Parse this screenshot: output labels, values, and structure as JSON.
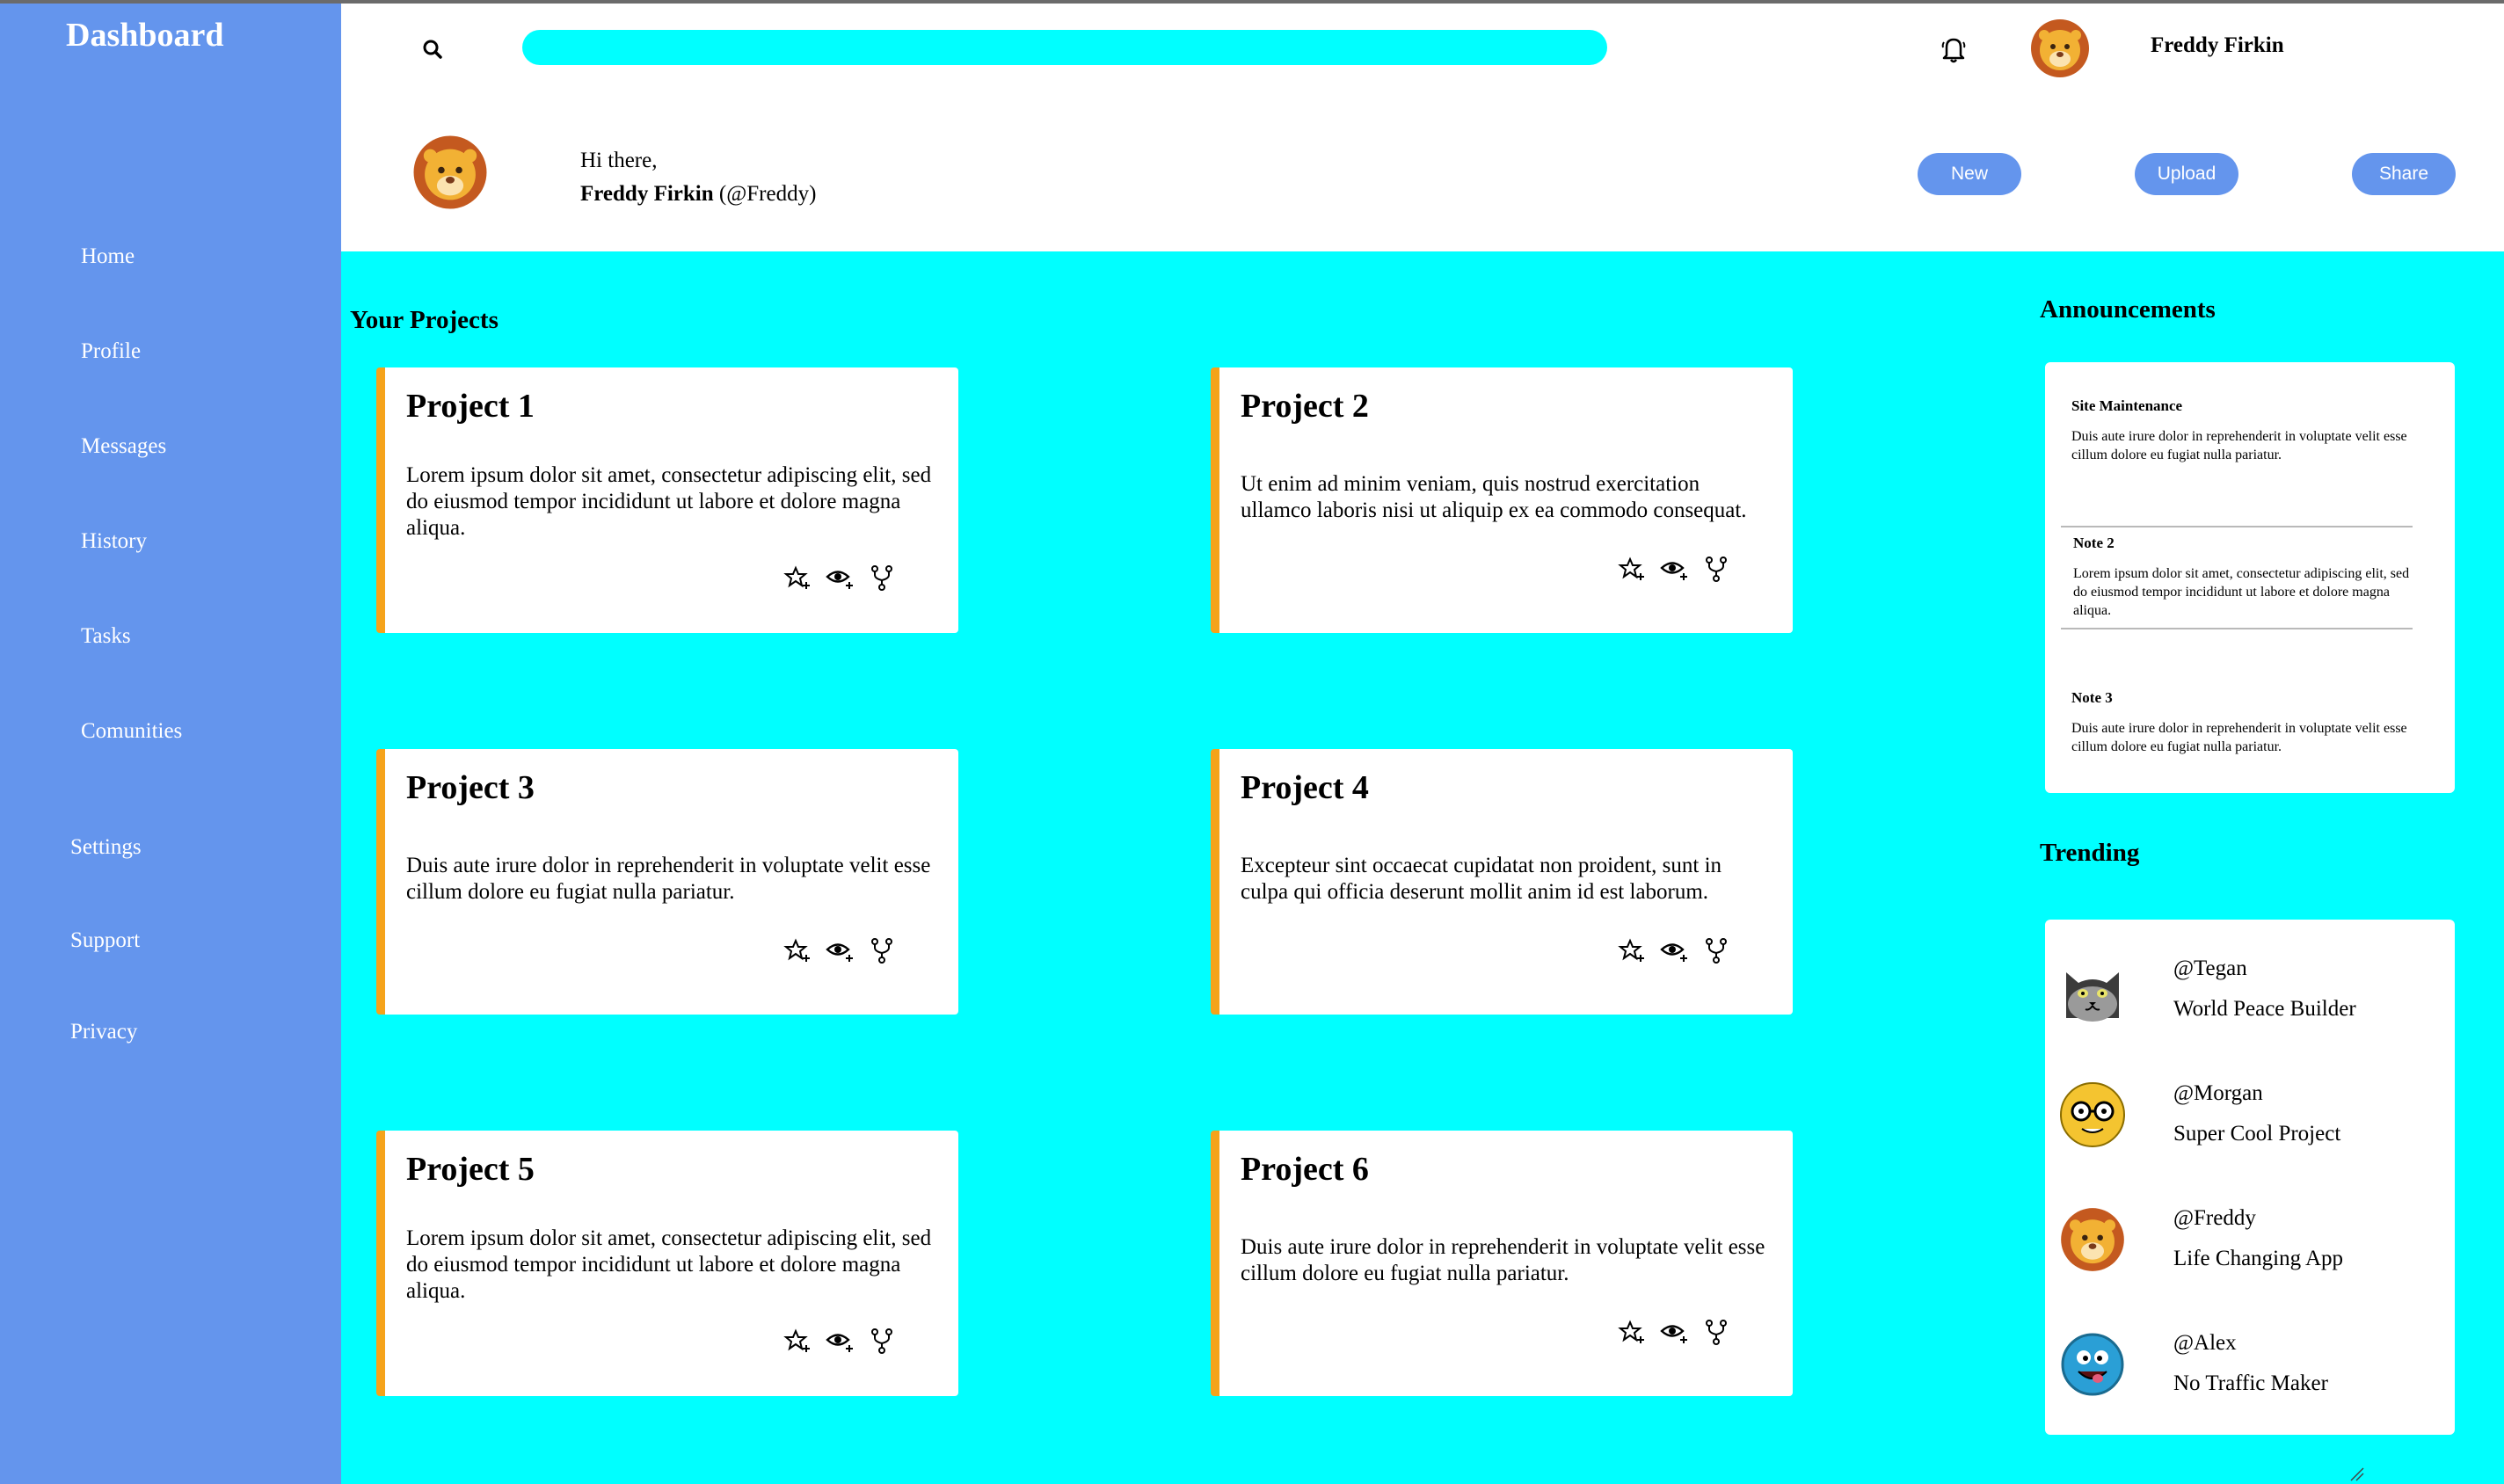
{
  "sidebar": {
    "title": "Dashboard",
    "items": [
      {
        "label": "Home"
      },
      {
        "label": "Profile"
      },
      {
        "label": "Messages"
      },
      {
        "label": "History"
      },
      {
        "label": "Tasks"
      },
      {
        "label": "Comunities"
      },
      {
        "label": "Settings"
      },
      {
        "label": "Support"
      },
      {
        "label": "Privacy"
      }
    ]
  },
  "header": {
    "search": {
      "placeholder": "",
      "value": ""
    },
    "username": "Freddy Firkin",
    "greeting": "Hi there,",
    "full_name": "Freddy Firkin",
    "handle": "(@Freddy)",
    "buttons": {
      "new": "New",
      "upload": "Upload",
      "share": "Share"
    }
  },
  "projects": {
    "title": "Your Projects",
    "items": [
      {
        "title": "Project 1",
        "text": "Lorem ipsum dolor sit amet, consectetur adipiscing elit, sed do eiusmod tempor incididunt ut labore et dolore magna aliqua."
      },
      {
        "title": "Project 2",
        "text": "Ut enim ad minim veniam, quis nostrud exercitation ullamco laboris nisi ut aliquip ex ea commodo consequat."
      },
      {
        "title": "Project 3",
        "text": "Duis aute irure dolor in reprehenderit in voluptate velit esse cillum dolore eu fugiat nulla pariatur."
      },
      {
        "title": "Project 4",
        "text": "Excepteur sint occaecat cupidatat non proident, sunt in culpa qui officia deserunt mollit anim id est laborum."
      },
      {
        "title": "Project 5",
        "text": "Lorem ipsum dolor sit amet, consectetur adipiscing elit, sed do eiusmod tempor incididunt ut labore et dolore magna aliqua."
      },
      {
        "title": "Project 6",
        "text": "Duis aute irure dolor in reprehenderit in voluptate velit esse cillum dolore eu fugiat nulla pariatur."
      }
    ]
  },
  "announcements": {
    "title": "Announcements",
    "notes": [
      {
        "title": "Site Maintenance",
        "text": "Duis aute irure dolor in reprehenderit in voluptate velit esse cillum dolore eu fugiat nulla pariatur."
      },
      {
        "title": "Note 2",
        "text": "Lorem ipsum dolor sit amet, consectetur adipiscing elit, sed do eiusmod tempor incididunt ut labore et dolore magna aliqua."
      },
      {
        "title": "Note 3",
        "text": "Duis aute irure dolor in reprehenderit in voluptate velit esse cillum dolore eu fugiat nulla pariatur."
      }
    ]
  },
  "trending": {
    "title": "Trending",
    "items": [
      {
        "handle": "@Tegan",
        "project": "World Peace Builder",
        "avatar_icon": "cat-face-icon"
      },
      {
        "handle": "@Morgan",
        "project": "Super Cool Project",
        "avatar_icon": "nerd-face-icon"
      },
      {
        "handle": "@Freddy",
        "project": "Life Changing App",
        "avatar_icon": "lion-face-icon"
      },
      {
        "handle": "@Alex",
        "project": "No Traffic Maker",
        "avatar_icon": "goofy-face-icon"
      }
    ]
  },
  "colors": {
    "sidebar": "#6495ed",
    "main_bg": "#00ffff",
    "accent": "#f5a31a",
    "button": "#6495ed"
  }
}
